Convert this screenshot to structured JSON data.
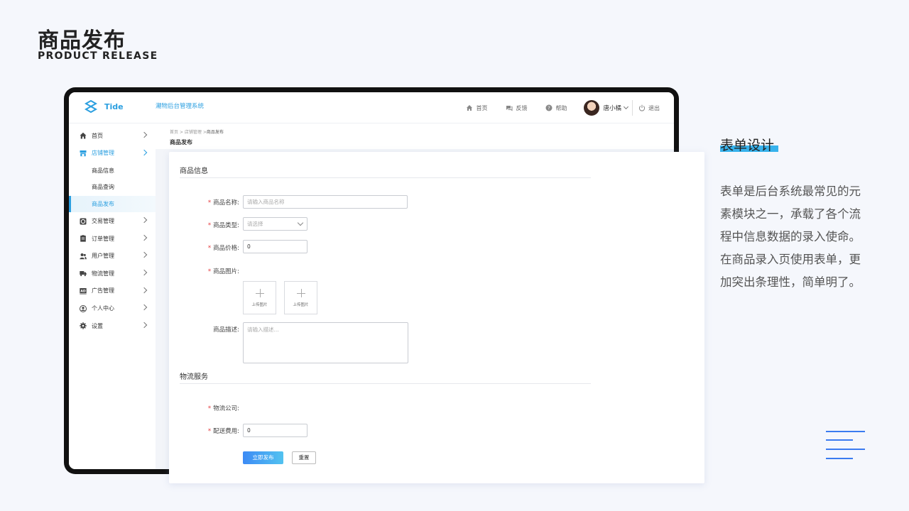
{
  "heading": {
    "title": "商品发布",
    "subtitle": "PRODUCT RELEASE"
  },
  "app": {
    "logo_text": "Tide",
    "system_name": "潮物后台管理系统",
    "top_nav": [
      {
        "label": "首页",
        "icon": "home-icon"
      },
      {
        "label": "反馈",
        "icon": "feedback-icon"
      },
      {
        "label": "帮助",
        "icon": "help-icon"
      }
    ],
    "user_name": "唐小橘",
    "logout_label": "退出"
  },
  "sidebar": {
    "items": [
      {
        "label": "首页",
        "icon": "home-icon"
      },
      {
        "label": "店铺管理",
        "icon": "store-icon",
        "active": true,
        "children": [
          "商品信息",
          "商品查询",
          "商品发布"
        ],
        "selected_child": 2
      },
      {
        "label": "交易管理",
        "icon": "trade-icon"
      },
      {
        "label": "订单管理",
        "icon": "order-icon"
      },
      {
        "label": "用户管理",
        "icon": "users-icon"
      },
      {
        "label": "物流管理",
        "icon": "truck-icon"
      },
      {
        "label": "广告管理",
        "icon": "ad-icon"
      },
      {
        "label": "个人中心",
        "icon": "user-icon"
      },
      {
        "label": "设置",
        "icon": "gear-icon"
      }
    ]
  },
  "breadcrumb": {
    "items": [
      "首页",
      "店铺管理",
      "商品发布"
    ],
    "separator": ">",
    "title": "商品发布"
  },
  "form": {
    "section_product": "商品信息",
    "name_label": "商品名称:",
    "name_placeholder": "请输入商品名称",
    "type_label": "商品类型:",
    "type_placeholder": "请选择",
    "price_label": "商品价格:",
    "price_value": "0",
    "image_label": "商品图片:",
    "upload_label": "上传图片",
    "desc_label": "商品描述:",
    "desc_placeholder": "请输入描述...",
    "section_logistics": "物流服务",
    "company_label": "物流公司:",
    "fee_label": "配送费用:",
    "fee_value": "0",
    "submit_label": "立即发布",
    "reset_label": "重置"
  },
  "description": {
    "title": "表单设计",
    "lines": [
      "表单是后台系统最常见的元",
      "素模块之一，承载了各个流",
      "程中信息数据的录入使命。",
      "在商品录入页使用表单，更",
      "加突出条理性，简单明了。"
    ]
  },
  "colors": {
    "accent": "#2b9fe0",
    "primary_gradient_start": "#3d8bf5",
    "primary_gradient_end": "#52c2f0",
    "required": "#e4393c",
    "title_bar": "#37b2ec"
  }
}
